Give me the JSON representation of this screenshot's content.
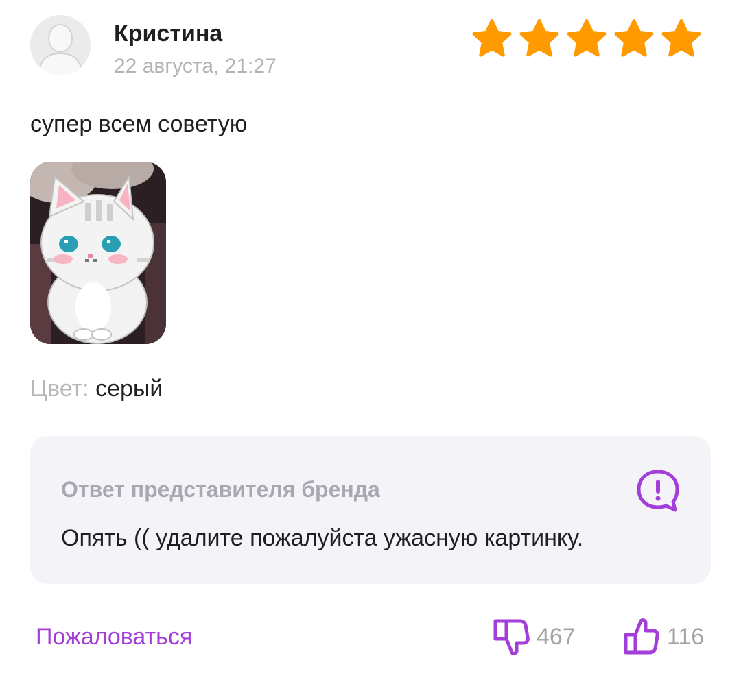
{
  "review": {
    "author": "Кристина",
    "date": "22 августа, 21:27",
    "rating": 5,
    "rating_max": 5,
    "text": "супер всем советую",
    "attribute_label": "Цвет:",
    "attribute_value": "серый"
  },
  "brand_reply": {
    "title": "Ответ представителя бренда",
    "text": "Опять (( удалите пожалуйста ужасную картинку."
  },
  "actions": {
    "report_label": "Пожаловаться",
    "dislike_count": "467",
    "like_count": "116"
  },
  "colors": {
    "star": "#ff9a00",
    "accent": "#a33ed8",
    "muted": "#b3b3b3",
    "brand_box_bg": "#f4f3f8"
  },
  "icons": {
    "avatar": "user-placeholder-icon",
    "star": "star-icon",
    "brand": "alert-chat-icon",
    "dislike": "thumbs-down-icon",
    "like": "thumbs-up-icon"
  }
}
